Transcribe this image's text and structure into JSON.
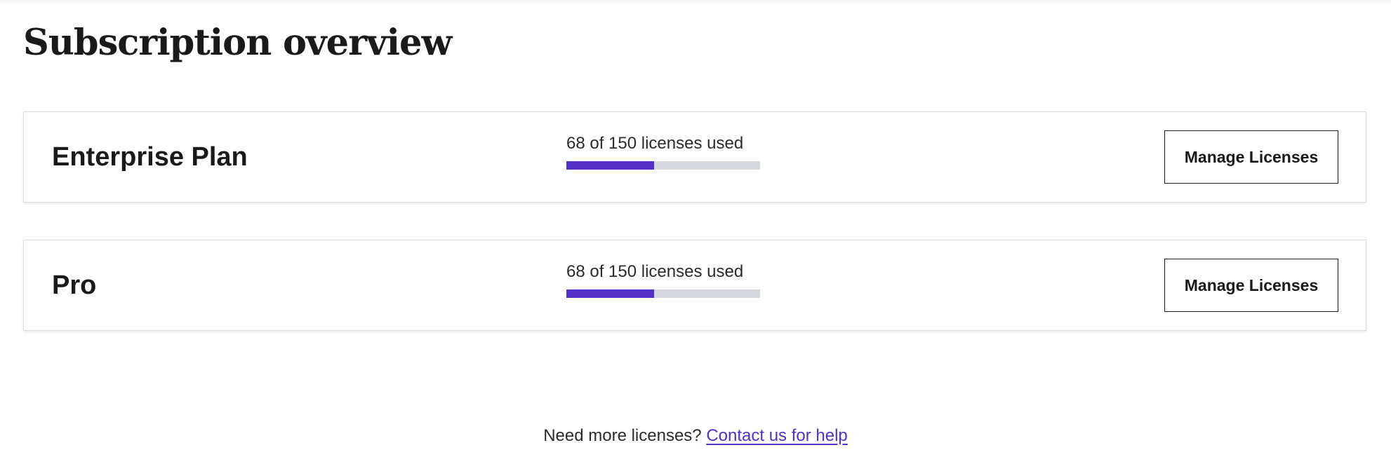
{
  "page": {
    "title": "Subscription overview"
  },
  "plans": [
    {
      "name": "Enterprise Plan",
      "usage_text": "68 of 150 licenses used",
      "used": 68,
      "total": 150,
      "button_label": "Manage Licenses"
    },
    {
      "name": "Pro",
      "usage_text": "68 of 150 licenses used",
      "used": 68,
      "total": 150,
      "button_label": "Manage Licenses"
    }
  ],
  "footer": {
    "prompt": "Need more licenses?",
    "link_label": "Contact us for help"
  },
  "colors": {
    "accent": "#5430c9",
    "track": "#d4d8dc",
    "border": "#dcdcdc",
    "text": "#1a1a1a"
  }
}
